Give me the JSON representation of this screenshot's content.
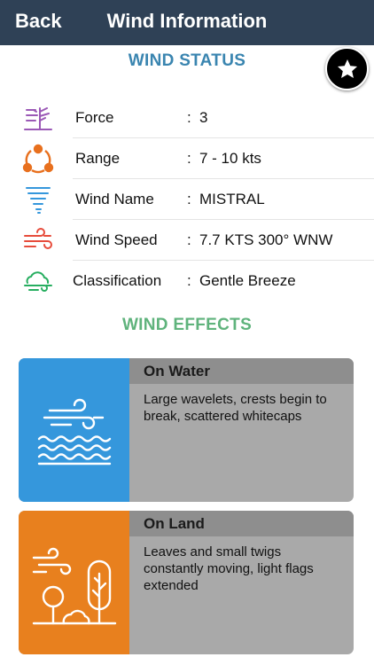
{
  "nav": {
    "back_label": "Back",
    "title": "Wind Information"
  },
  "favorite": {
    "icon": "star-icon"
  },
  "status": {
    "title": "WIND STATUS",
    "rows": [
      {
        "icon": "beaufort-scale-icon",
        "label": "Force",
        "value": "3"
      },
      {
        "icon": "range-nodes-icon",
        "label": "Range",
        "value": "7 - 10  kts"
      },
      {
        "icon": "tornado-icon",
        "label": "Wind Name",
        "value": "MISTRAL"
      },
      {
        "icon": "wind-speed-icon",
        "label": "Wind Speed",
        "value": "7.7 KTS 300° WNW"
      },
      {
        "icon": "cloud-wind-icon",
        "label": "Classification",
        "value": "Gentle Breeze"
      }
    ],
    "separator": ":"
  },
  "effects": {
    "title": "WIND EFFECTS",
    "cards": [
      {
        "icon": "wind-waves-icon",
        "heading": "On Water",
        "text": "Large wavelets, crests begin to break, scattered whitecaps",
        "color": "#3597dc"
      },
      {
        "icon": "wind-trees-icon",
        "heading": "On Land",
        "text": "Leaves and small twigs constantly moving, light flags extended",
        "color": "#e8801e"
      }
    ]
  },
  "colors": {
    "navbar": "#2f4156",
    "status_title": "#3a85b0",
    "effects_title": "#5fb37c",
    "card_body": "#a9a9a9",
    "card_head": "#8e8e8e"
  }
}
